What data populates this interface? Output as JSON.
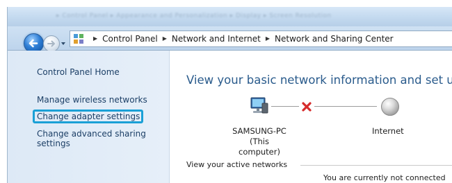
{
  "window": {
    "title_blur": "▸ Control Panel ▸ Appearance and Personalization ▸ Display ▸ Screen Resolution"
  },
  "address_bar": {
    "crumbs": [
      "Control Panel",
      "Network and Internet",
      "Network and Sharing Center"
    ]
  },
  "sidebar": {
    "home": "Control Panel Home",
    "items": [
      {
        "label": "Manage wireless networks"
      },
      {
        "label": "Change adapter settings",
        "highlighted": true
      },
      {
        "label": "Change advanced sharing",
        "label2": "settings"
      }
    ],
    "highlight_color": "#1aa0d6"
  },
  "main": {
    "heading": "View your basic network information and set up",
    "computer": {
      "name": "SAMSUNG-PC",
      "subtitle": "(This computer)"
    },
    "internet_label": "Internet",
    "connection_status_icon": "red-x-icon",
    "active_networks_label": "View your active networks",
    "not_connected_text": "You are currently not connected"
  },
  "colors": {
    "heading": "#2a5b8c",
    "link": "#1c3f66",
    "sidebar_bg": "#dde9f6",
    "disconnected": "#d62b2b"
  }
}
